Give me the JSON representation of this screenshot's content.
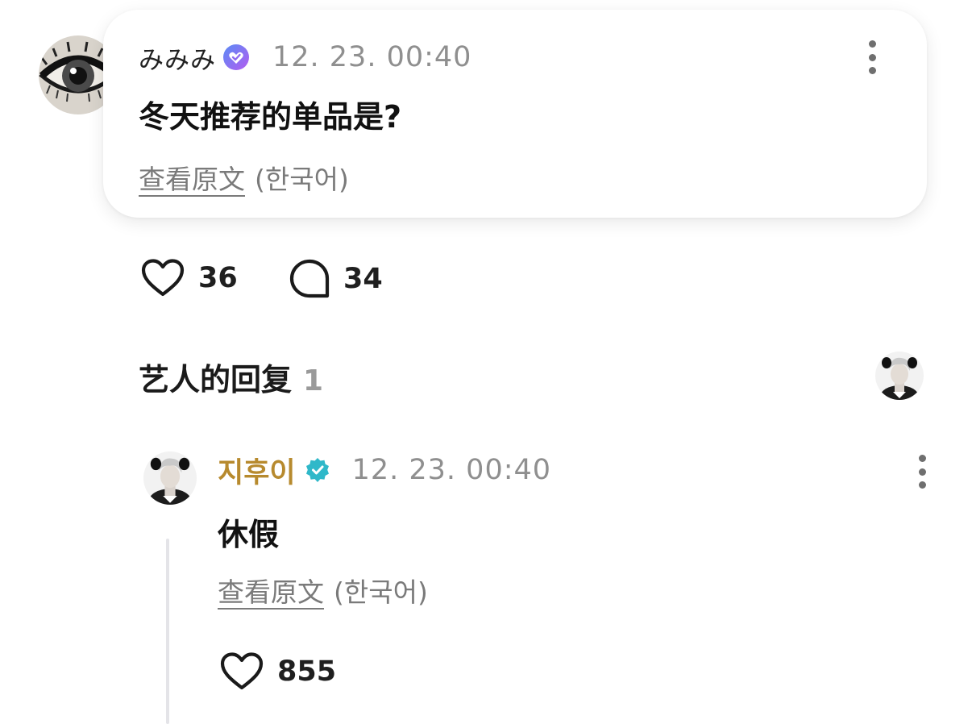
{
  "post": {
    "author": "みみみ",
    "timestamp": "12. 23. 00:40",
    "text": "冬天推荐的单品是?",
    "translate_link": "查看原文",
    "translate_lang": "(한국어)",
    "likes": "36",
    "comments": "34",
    "verified_badge_color": "#8f6cf0"
  },
  "section": {
    "title": "艺人的回复",
    "count": "1"
  },
  "reply": {
    "author": "지후이",
    "author_color": "#b78a2e",
    "timestamp": "12. 23. 00:40",
    "text": "休假",
    "translate_link": "查看原文",
    "translate_lang": "(한국어)",
    "likes": "855",
    "verified_badge_color": "#2fb8c9"
  },
  "icons": {
    "post_menu": "more-vertical-icon",
    "like": "heart-outline-icon",
    "comment": "speech-bubble-icon",
    "reply_menu": "more-vertical-icon"
  }
}
